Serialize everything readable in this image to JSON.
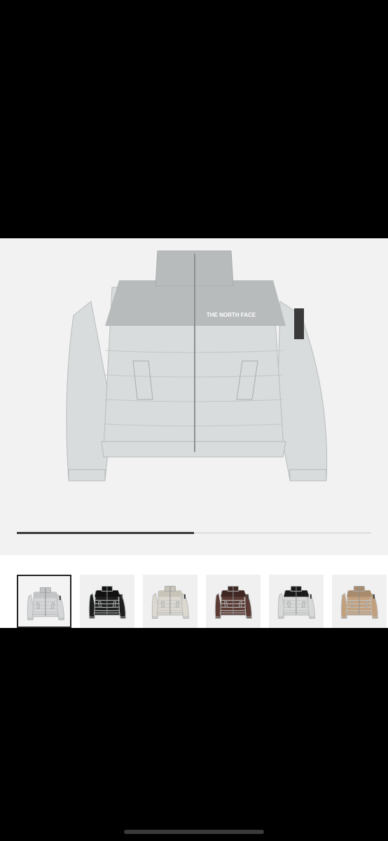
{
  "product": {
    "main_image": {
      "icon": "puffer-jacket-image",
      "body_color": "#d9dcdd",
      "yoke_color": "#b8bbbc",
      "logo_text": "THE NORTH FACE"
    },
    "carousel": {
      "progress": 0.5
    },
    "thumbnails": [
      {
        "name": "light-grey",
        "color": "#d4d6d7",
        "yoke": "#c2c4c5",
        "selected": true
      },
      {
        "name": "black",
        "color": "#1e1e1e",
        "yoke": "#111111",
        "selected": false
      },
      {
        "name": "cream",
        "color": "#dcd8cf",
        "yoke": "#c9c4b8",
        "selected": false
      },
      {
        "name": "brown",
        "color": "#5a3a33",
        "yoke": "#3f2823",
        "selected": false
      },
      {
        "name": "silver-black",
        "color": "#d8d8d8",
        "yoke": "#1a1a1a",
        "selected": false
      },
      {
        "name": "tan",
        "color": "#c2a07e",
        "yoke": "#a88a6c",
        "selected": false
      }
    ]
  }
}
